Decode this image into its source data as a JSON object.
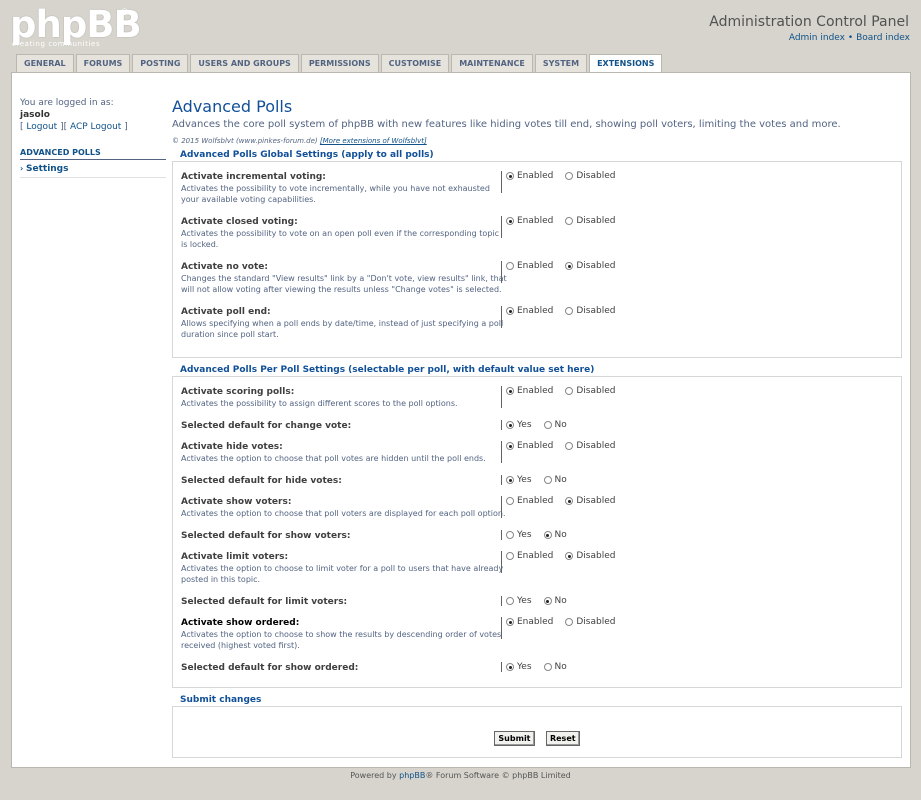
{
  "header": {
    "logo_text": "phpBB",
    "logo_reg": "®",
    "logo_slogan": "creating  communities",
    "acp_title": "Administration Control Panel",
    "admin_index": "Admin index",
    "separator": "•",
    "board_index": "Board index"
  },
  "tabs": [
    {
      "label": "GENERAL"
    },
    {
      "label": "FORUMS"
    },
    {
      "label": "POSTING"
    },
    {
      "label": "USERS AND GROUPS"
    },
    {
      "label": "PERMISSIONS"
    },
    {
      "label": "CUSTOMISE"
    },
    {
      "label": "MAINTENANCE"
    },
    {
      "label": "SYSTEM"
    },
    {
      "label": "EXTENSIONS"
    }
  ],
  "active_tab": "EXTENSIONS",
  "sidebar": {
    "logged_in_as": "You are logged in as:",
    "username": "jasolo",
    "logout": "Logout",
    "acp_logout": "ACP Logout",
    "menu_header": "ADVANCED POLLS",
    "menu_item": "Settings"
  },
  "page": {
    "title": "Advanced Polls",
    "description": "Advances the core poll system of phpBB with new features like hiding votes till end, showing poll voters, limiting the votes and more.",
    "copyright_prefix": "© 2015 Wolfsblvt (www.pinkes-forum.de)",
    "copyright_link": "[More extensions of Wolfsblvt]"
  },
  "global": {
    "legend": "Advanced Polls Global Settings (apply to all polls)",
    "rows": [
      {
        "title": "Activate incremental voting:",
        "explain": "Activates the possibility to vote incrementally, while you have not exhausted your available voting capabilities.",
        "opt1": "Enabled",
        "opt2": "Disabled",
        "selected": 1
      },
      {
        "title": "Activate closed voting:",
        "explain": "Activates the possibility to vote on an open poll even if the corresponding topic is locked.",
        "opt1": "Enabled",
        "opt2": "Disabled",
        "selected": 1
      },
      {
        "title": "Activate no vote:",
        "explain": "Changes the standard \"View results\" link by a \"Don't vote, view results\" link, that will not allow voting after viewing the results unless \"Change votes\" is selected.",
        "opt1": "Enabled",
        "opt2": "Disabled",
        "selected": 2
      },
      {
        "title": "Activate poll end:",
        "explain": "Allows specifying when a poll ends by date/time, instead of just specifying a poll duration since poll start.",
        "opt1": "Enabled",
        "opt2": "Disabled",
        "selected": 1
      }
    ]
  },
  "perpoll": {
    "legend": "Advanced Polls Per Poll Settings (selectable per poll, with default value set here)",
    "rows": [
      {
        "title": "Activate scoring polls:",
        "explain": "Activates the possibility to assign different scores to the poll options.",
        "opt1": "Enabled",
        "opt2": "Disabled",
        "selected": 1
      },
      {
        "title": "Selected default for change vote:",
        "explain": "",
        "opt1": "Yes",
        "opt2": "No",
        "selected": 1
      },
      {
        "title": "Activate hide votes:",
        "explain": "Activates the option to choose that poll votes are hidden until the poll ends.",
        "opt1": "Enabled",
        "opt2": "Disabled",
        "selected": 1
      },
      {
        "title": "Selected default for hide votes:",
        "explain": "",
        "opt1": "Yes",
        "opt2": "No",
        "selected": 1
      },
      {
        "title": "Activate show voters:",
        "explain": "Activates the option to choose that poll voters are displayed for each poll option.",
        "opt1": "Enabled",
        "opt2": "Disabled",
        "selected": 2
      },
      {
        "title": "Selected default for show voters:",
        "explain": "",
        "opt1": "Yes",
        "opt2": "No",
        "selected": 2
      },
      {
        "title": "Activate limit voters:",
        "explain": "Activates the option to choose to limit voter for a poll to users that have already posted in this topic.",
        "opt1": "Enabled",
        "opt2": "Disabled",
        "selected": 2
      },
      {
        "title": "Selected default for limit voters:",
        "explain": "",
        "opt1": "Yes",
        "opt2": "No",
        "selected": 2
      },
      {
        "title": "Activate show ordered:",
        "explain": "Activates the option to choose to show the results by descending order of votes received (highest voted first).",
        "opt1": "Enabled",
        "opt2": "Disabled",
        "selected": 1
      },
      {
        "title": "Selected default for show ordered:",
        "explain": "",
        "opt1": "Yes",
        "opt2": "No",
        "selected": 1
      }
    ]
  },
  "submit": {
    "legend": "Submit changes",
    "submit_label": "Submit",
    "reset_label": "Reset"
  },
  "footer": {
    "prefix": "Powered by",
    "link": "phpBB",
    "suffix": "® Forum Software © phpBB Limited"
  }
}
